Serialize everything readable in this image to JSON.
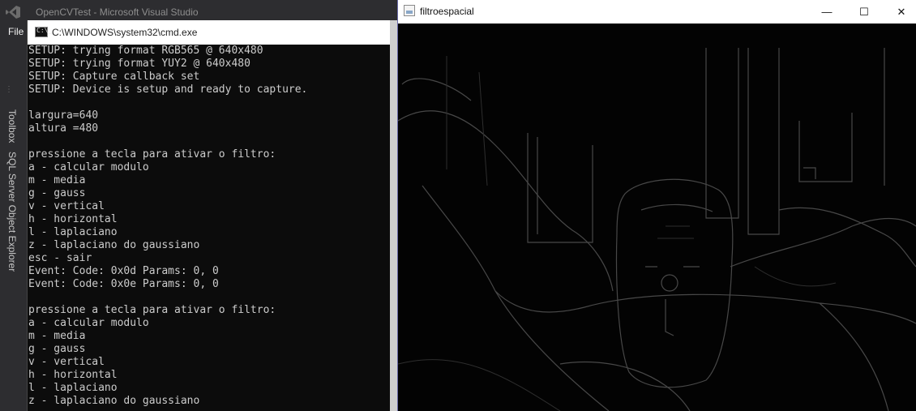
{
  "vs": {
    "title": "OpenCVTest - Microsoft Visual Studio",
    "menu_file": "File",
    "side_tabs": [
      "Toolbox",
      "SQL Server Object Explorer"
    ]
  },
  "cmd": {
    "title": "C:\\WINDOWS\\system32\\cmd.exe",
    "icon_prompt": "C:\\_",
    "lines": [
      "SETUP: trying format RGB565 @ 640x480",
      "SETUP: trying format YUY2 @ 640x480",
      "SETUP: Capture callback set",
      "SETUP: Device is setup and ready to capture.",
      "",
      "largura=640",
      "altura =480",
      "",
      "pressione a tecla para ativar o filtro:",
      "a - calcular modulo",
      "m - media",
      "g - gauss",
      "v - vertical",
      "h - horizontal",
      "l - laplaciano",
      "z - laplaciano do gaussiano",
      "esc - sair",
      "Event: Code: 0x0d Params: 0, 0",
      "Event: Code: 0x0e Params: 0, 0",
      "",
      "pressione a tecla para ativar o filtro:",
      "a - calcular modulo",
      "m - media",
      "g - gauss",
      "v - vertical",
      "h - horizontal",
      "l - laplaciano",
      "z - laplaciano do gaussiano"
    ]
  },
  "image_window": {
    "title": "filtroespacial",
    "minimize_glyph": "—",
    "maximize_glyph": "☐",
    "close_glyph": "✕"
  },
  "colors": {
    "console_bg": "#0c0c0c",
    "console_text": "#cccccc",
    "edge_stroke": "#4a4a4a"
  }
}
